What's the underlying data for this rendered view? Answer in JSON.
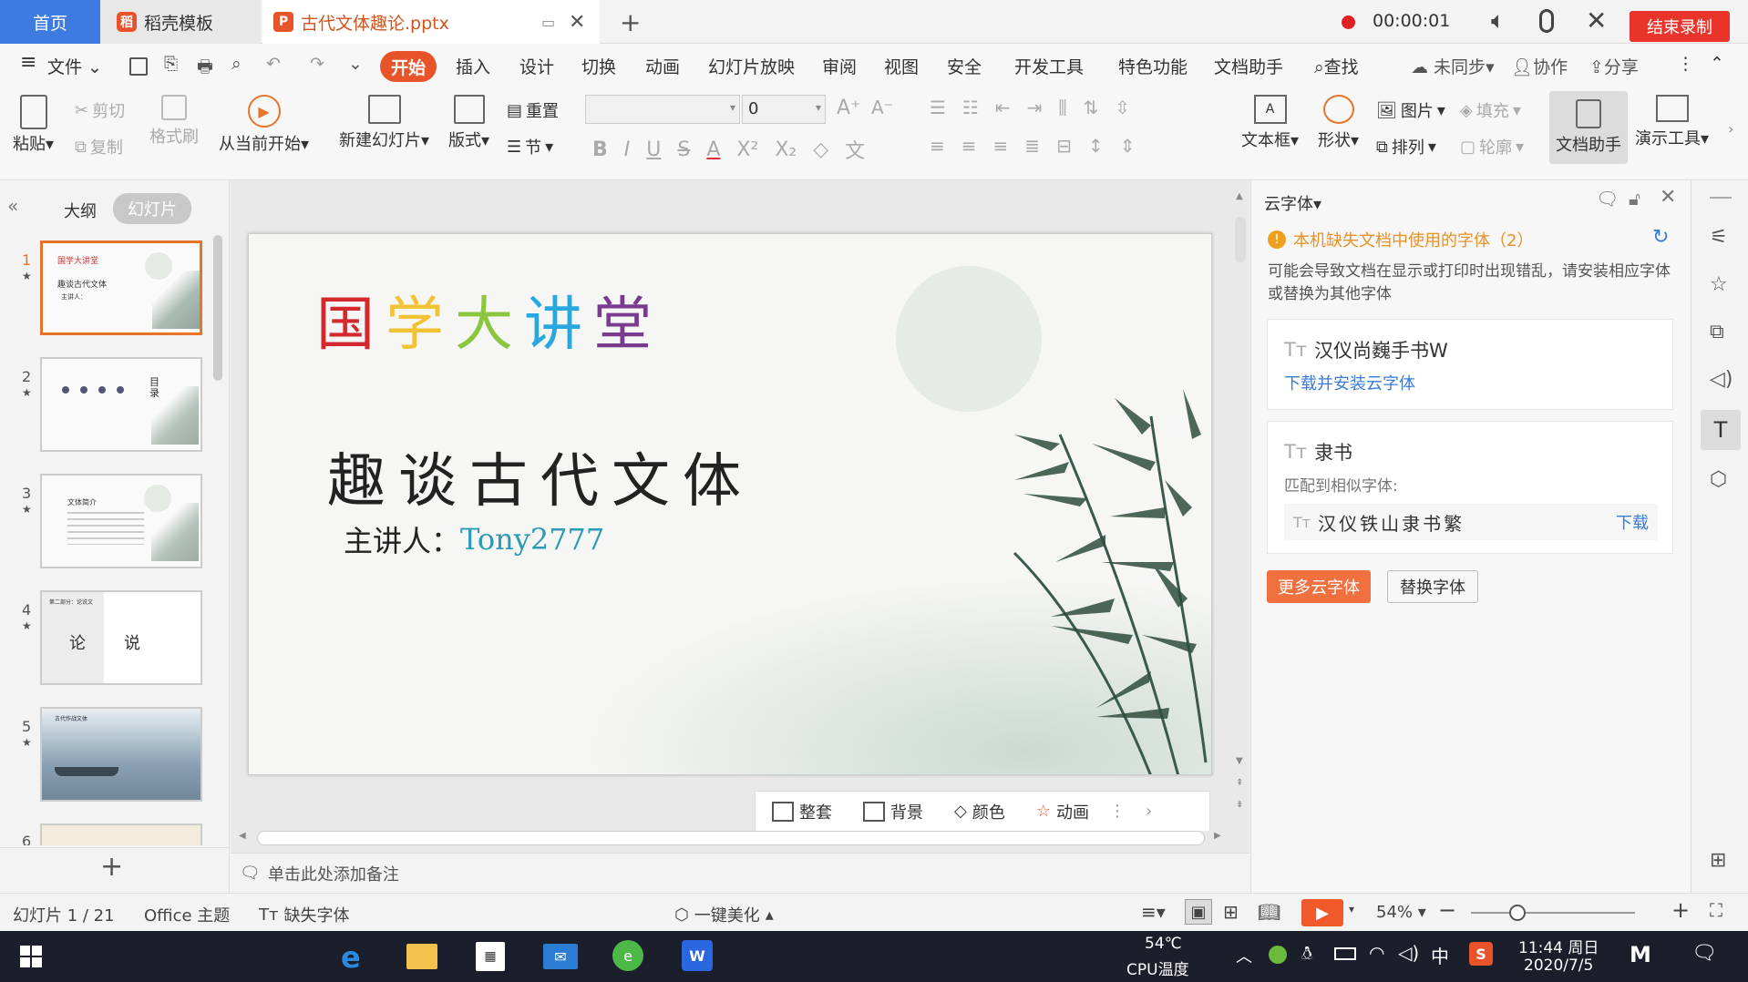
{
  "tabs": {
    "home": "首页",
    "template": "稻壳模板",
    "file": "古代文体趣论.pptx"
  },
  "recording": {
    "time": "00:00:01",
    "end_label": "结束录制"
  },
  "menu": {
    "file": "文件",
    "items": [
      "开始",
      "插入",
      "设计",
      "切换",
      "动画",
      "幻灯片放映",
      "审阅",
      "视图",
      "安全",
      "开发工具",
      "特色功能",
      "文档助手"
    ],
    "search": "查找",
    "sync": "未同步",
    "collab": "协作",
    "share": "分享"
  },
  "ribbon": {
    "paste": "粘贴",
    "cut": "剪切",
    "copy": "复制",
    "format_painter": "格式刷",
    "play_from_current": "从当前开始",
    "new_slide": "新建幻灯片",
    "layout": "版式",
    "reset": "重置",
    "section": "节",
    "font_size": "0",
    "textbox": "文本框",
    "shape": "形状",
    "picture": "图片",
    "fill": "填充",
    "arrange": "排列",
    "outline": "轮廓",
    "doc_assistant": "文档助手",
    "presenter_tools": "演示工具"
  },
  "left_panel": {
    "outline_tab": "大纲",
    "slides_tab": "幻灯片",
    "slide_numbers": [
      "1",
      "2",
      "3",
      "4",
      "5",
      "6"
    ]
  },
  "thumbs": {
    "t1_title": "国学大讲堂",
    "t1_sub": "趣谈古代文体",
    "t1_speaker": "主讲人：",
    "t2_label": "目录",
    "t3_title": "文体简介",
    "t4_header": "第二部分：论说文",
    "t4_a": "论",
    "t4_b": "说",
    "t5_title": "古代作战文体"
  },
  "slide": {
    "title_chars": [
      "国",
      "学",
      "大",
      "讲",
      "堂"
    ],
    "title_colors": [
      "#d3282e",
      "#f1c232",
      "#8cc63e",
      "#29a8df",
      "#7a3b8f"
    ],
    "subtitle": "趣谈古代文体",
    "speaker_label": "主讲人：",
    "speaker_name": "Tony2777"
  },
  "slide_toolbar": {
    "rearrange": "整套",
    "background": "背景",
    "color": "颜色",
    "animation": "动画"
  },
  "notes_placeholder": "单击此处添加备注",
  "right_panel": {
    "title": "云字体",
    "warning": "本机缺失文档中使用的字体（2）",
    "description": "可能会导致文档在显示或打印时出现错乱，请安装相应字体或替换为其他字体",
    "font1_name": "汉仪尚巍手书W",
    "font1_action": "下载并安装云字体",
    "font2_name": "隶书",
    "font2_match_label": "匹配到相似字体:",
    "font2_match": "汉仪铁山隶书繁",
    "font2_download": "下载",
    "more_fonts": "更多云字体",
    "replace_fonts": "替换字体"
  },
  "status": {
    "slide_count": "幻灯片 1 / 21",
    "theme": "Office 主题",
    "missing_font": "缺失字体",
    "beautify": "一键美化",
    "zoom": "54%"
  },
  "taskbar": {
    "temp": "54℃",
    "cpu_label": "CPU温度",
    "ime": "中",
    "time": "11:44 周日",
    "date": "2020/7/5"
  },
  "colors": {
    "accent": "#e8542a",
    "blue": "#3d7be0",
    "link": "#3a7bd5",
    "warning": "#f0a020"
  }
}
